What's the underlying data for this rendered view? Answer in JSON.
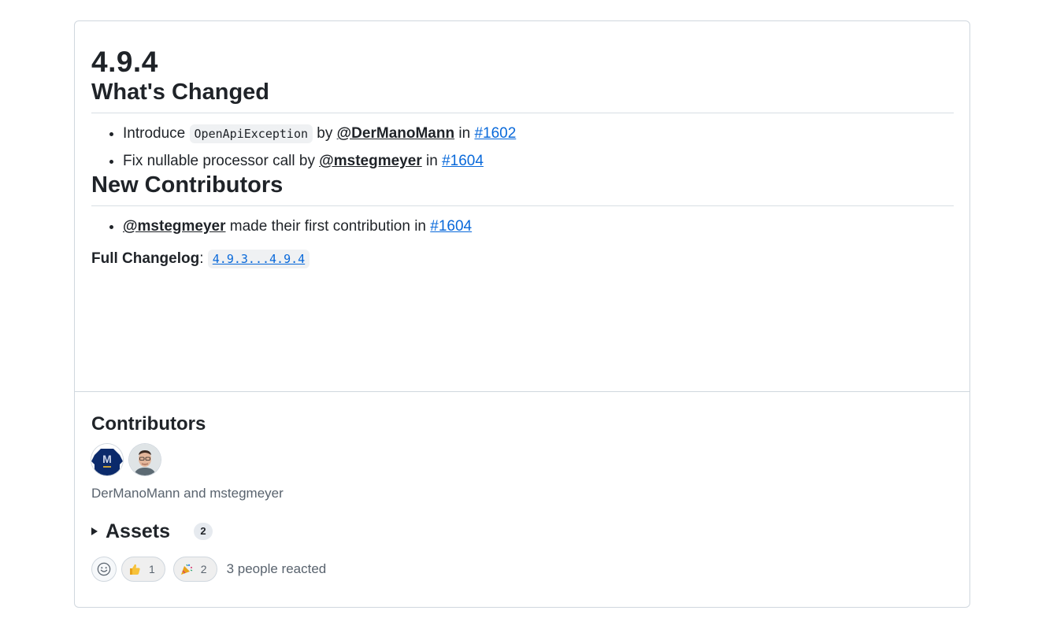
{
  "release": {
    "title": "4.9.4",
    "whats_changed": {
      "heading": "What's Changed",
      "items": [
        {
          "prefix": "Introduce",
          "code": "OpenApiException",
          "by": "by",
          "author": "@DerManoMann",
          "in": "in",
          "pr": "#1602"
        },
        {
          "prefix": "Fix nullable processor call",
          "by": "by",
          "author": "@mstegmeyer",
          "in": "in",
          "pr": "#1604"
        }
      ]
    },
    "new_contributors": {
      "heading": "New Contributors",
      "items": [
        {
          "author": "@mstegmeyer",
          "text": "made their first contribution in",
          "pr": "#1604"
        }
      ]
    },
    "changelog": {
      "label": "Full Changelog",
      "sep": ":",
      "link": "4.9.3...4.9.4"
    }
  },
  "contributors": {
    "heading": "Contributors",
    "names": "DerManoMann and mstegmeyer",
    "avatars": [
      "DerManoMann",
      "mstegmeyer"
    ]
  },
  "assets": {
    "label": "Assets",
    "count": "2"
  },
  "reactions": {
    "items": [
      {
        "emoji": "thumbs-up-icon",
        "count": "1"
      },
      {
        "emoji": "party-popper-icon",
        "count": "2"
      }
    ],
    "summary": "3 people reacted"
  },
  "colors": {
    "link": "#0969da",
    "text": "#1f2328",
    "muted": "#59636e",
    "border": "#d0d7de"
  }
}
